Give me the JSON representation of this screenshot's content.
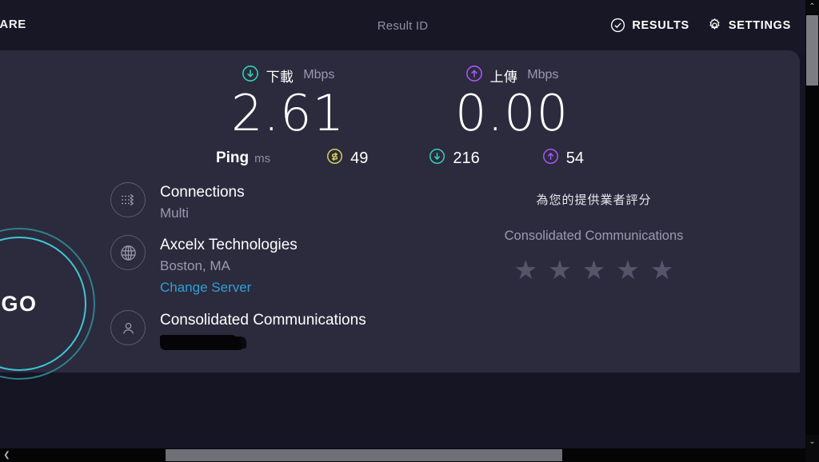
{
  "header": {
    "share_label": "HARE",
    "result_id": "Result ID",
    "results_label": "RESULTS",
    "settings_label": "SETTINGS",
    "results_icon": "check-circle-icon",
    "settings_icon": "gear-icon"
  },
  "speeds": {
    "download": {
      "icon": "download-arrow-circle-icon",
      "label": "下載",
      "unit": "Mbps",
      "value": "2.61",
      "color": "#34d0b8"
    },
    "upload": {
      "icon": "upload-arrow-circle-icon",
      "label": "上傳",
      "unit": "Mbps",
      "value": "0.00",
      "color": "#a855f7"
    }
  },
  "ping": {
    "label": "Ping",
    "unit": "ms",
    "idle": {
      "icon": "idle-latency-icon",
      "value": "49",
      "color": "#d8cf5a"
    },
    "download": {
      "icon": "download-arrow-circle-icon",
      "value": "216",
      "color": "#34d0b8"
    },
    "upload": {
      "icon": "upload-arrow-circle-icon",
      "value": "54",
      "color": "#a855f7"
    }
  },
  "go_button": {
    "label": "GO"
  },
  "connection": {
    "connections": {
      "icon": "multi-connection-icon",
      "title": "Connections",
      "subtitle": "Multi"
    },
    "server": {
      "icon": "globe-icon",
      "title": "Axcelx Technologies",
      "subtitle": "Boston, MA",
      "link": "Change Server"
    },
    "client": {
      "icon": "person-icon",
      "title": "Consolidated Communications",
      "ip_redacted": ""
    }
  },
  "rating": {
    "question": "為您的提供業者評分",
    "isp": "Consolidated Communications",
    "stars": [
      "★",
      "★",
      "★",
      "★",
      "★"
    ],
    "filled_count": 0,
    "star_color": "#54556b"
  },
  "scrollbars": {
    "vertical": {
      "up": "⌃",
      "down": "⌄"
    },
    "horizontal": {
      "left": "❮",
      "right": "❯"
    }
  }
}
